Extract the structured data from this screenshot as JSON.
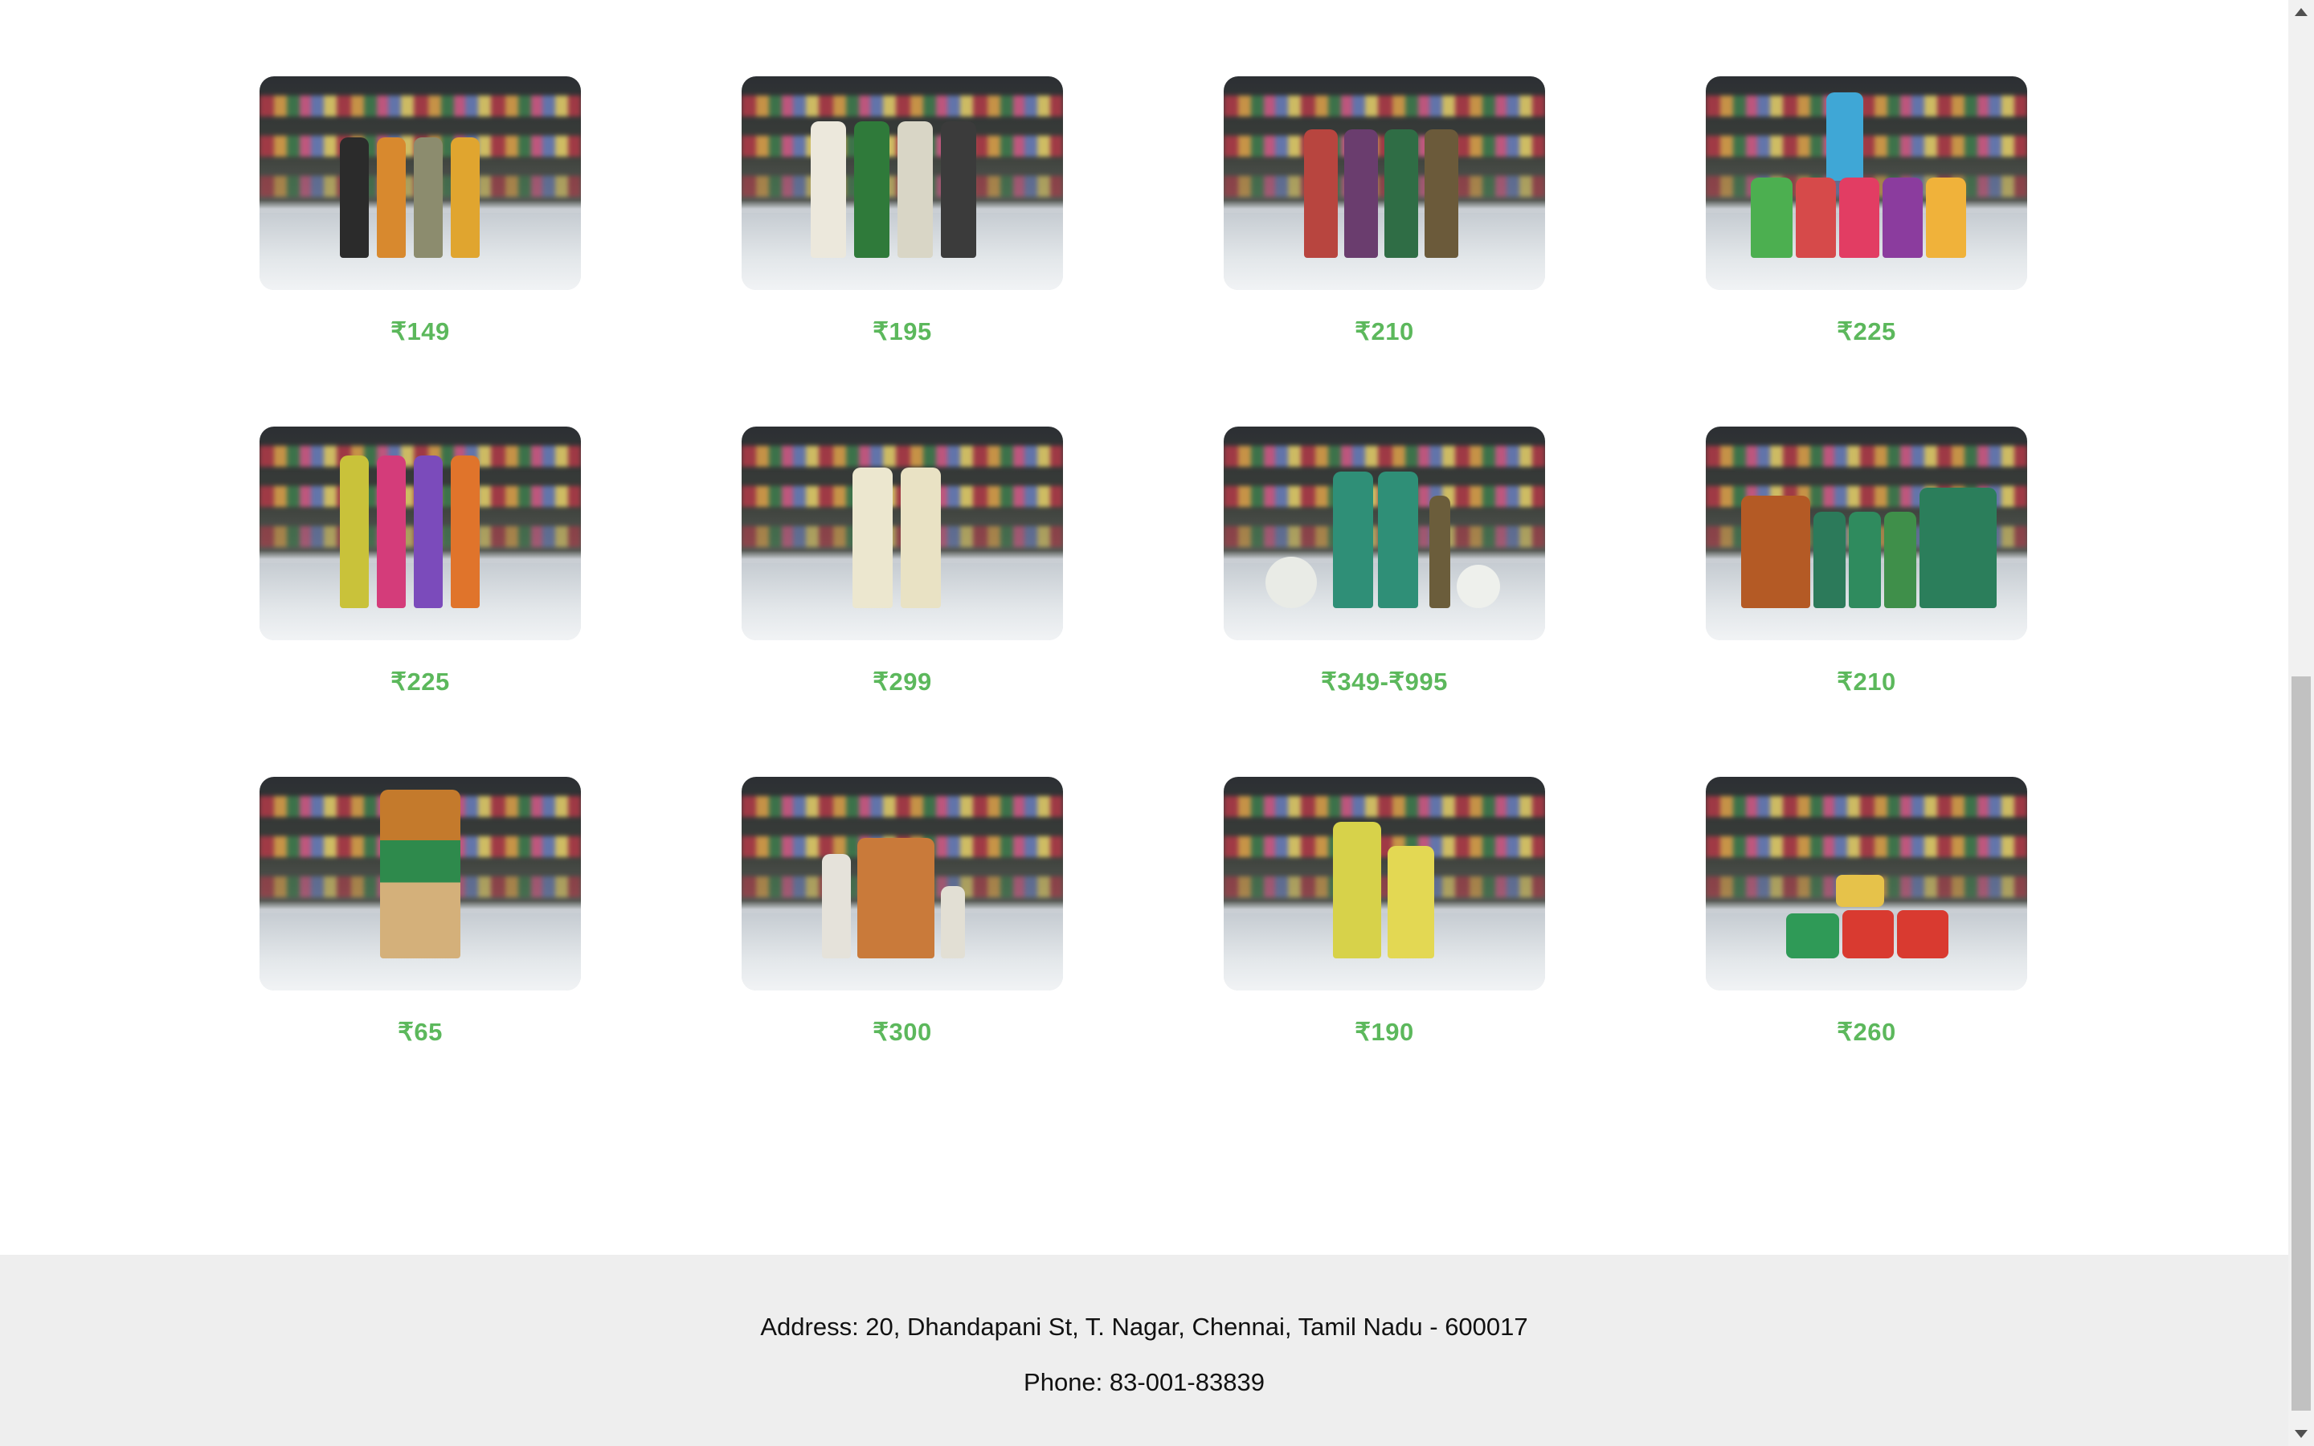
{
  "products": [
    {
      "price": "₹149",
      "photo": "face-wash-bottles-photo"
    },
    {
      "price": "₹195",
      "photo": "hair-oil-bottles-photo"
    },
    {
      "price": "₹210",
      "photo": "shampoo-bottles-photo"
    },
    {
      "price": "₹225",
      "photo": "herbal-boxes-photo"
    },
    {
      "price": "₹225",
      "photo": "spray-bottles-photo"
    },
    {
      "price": "₹299",
      "photo": "lotion-bottles-photo"
    },
    {
      "price": "₹349-₹995",
      "photo": "skin-care-set-photo"
    },
    {
      "price": "₹210",
      "photo": "tea-packs-photo"
    },
    {
      "price": "₹65",
      "photo": "small-oil-bottles-photo"
    },
    {
      "price": "₹300",
      "photo": "sandal-powder-photo"
    },
    {
      "price": "₹190",
      "photo": "eucalyptus-oil-photo"
    },
    {
      "price": "₹260",
      "photo": "balm-jars-photo"
    }
  ],
  "footer": {
    "address": "Address: 20, Dhandapani St, T. Nagar, Chennai, Tamil Nadu - 600017",
    "phone": "Phone: 83-001-83839"
  },
  "colors": {
    "price": "#5cb85c",
    "footer_bg": "#eeeeee"
  }
}
